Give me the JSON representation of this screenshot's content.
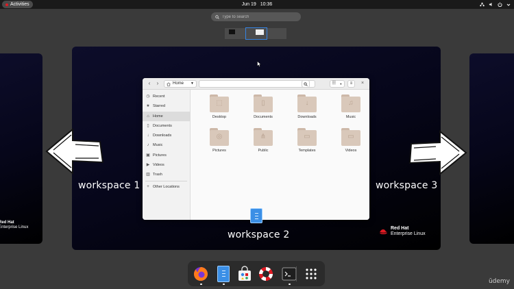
{
  "topbar": {
    "activities": "Activities",
    "date": "Jun 19",
    "time": "10:36"
  },
  "search": {
    "placeholder": "Type to search"
  },
  "workspaces": {
    "left_label": "workspace 1",
    "center_label": "workspace 2",
    "right_label": "workspace 3",
    "brand_line1": "Red Hat",
    "brand_line2": "Enterprise Linux"
  },
  "files_window": {
    "path": "Home",
    "sidebar": [
      {
        "label": "Recent",
        "icon": "clock-icon"
      },
      {
        "label": "Starred",
        "icon": "star-icon"
      },
      {
        "label": "Home",
        "icon": "home-icon"
      },
      {
        "label": "Documents",
        "icon": "document-icon"
      },
      {
        "label": "Downloads",
        "icon": "download-icon"
      },
      {
        "label": "Music",
        "icon": "music-icon"
      },
      {
        "label": "Pictures",
        "icon": "picture-icon"
      },
      {
        "label": "Videos",
        "icon": "video-icon"
      },
      {
        "label": "Trash",
        "icon": "trash-icon"
      },
      {
        "label": "Other Locations",
        "icon": "plus-icon"
      }
    ],
    "folders": [
      "Desktop",
      "Documents",
      "Downloads",
      "Music",
      "Pictures",
      "Public",
      "Templates",
      "Videos"
    ]
  },
  "watermark": "ūdemy"
}
